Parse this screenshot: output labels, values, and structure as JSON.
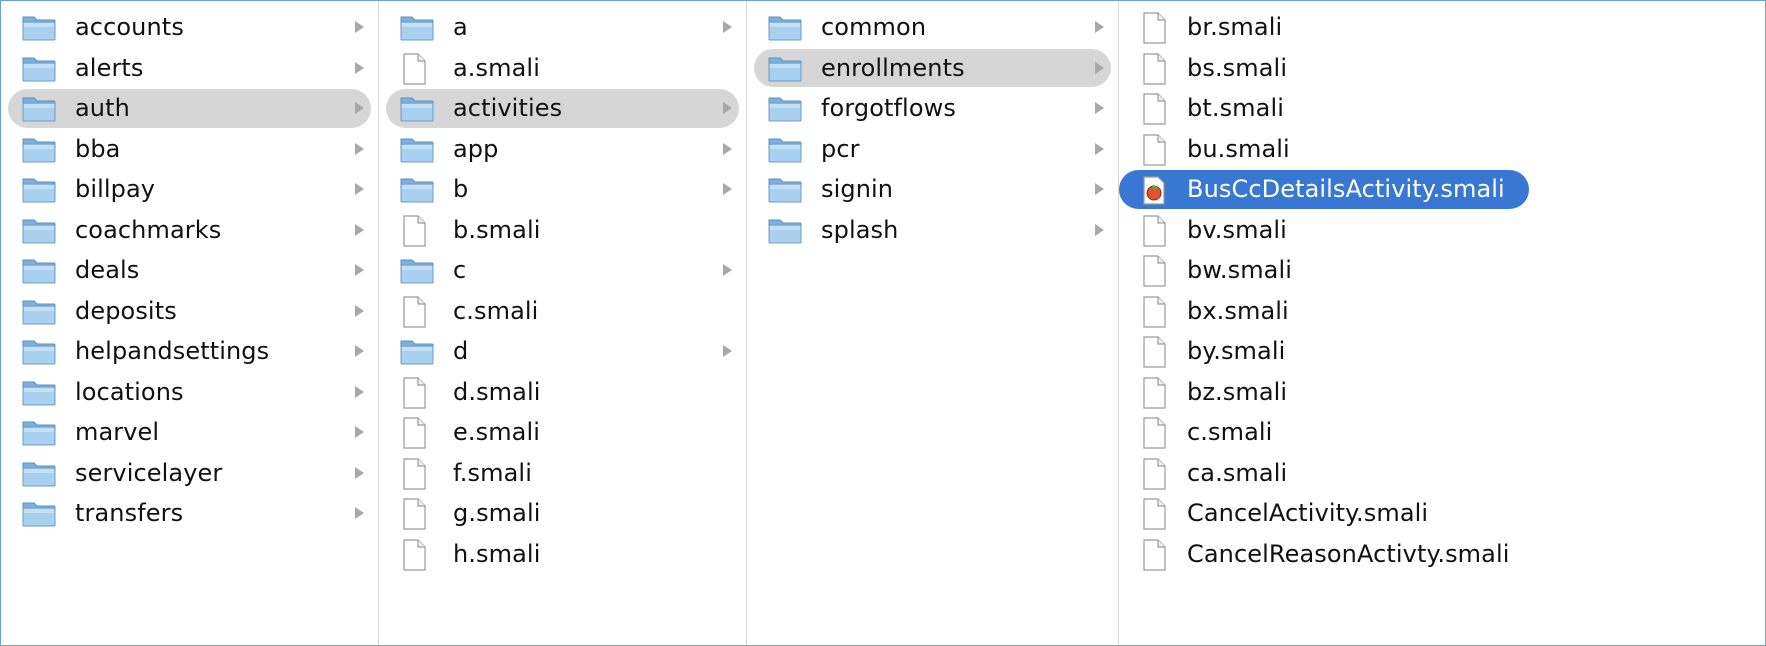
{
  "columns": [
    {
      "items": [
        {
          "label": "accounts",
          "kind": "folder"
        },
        {
          "label": "alerts",
          "kind": "folder"
        },
        {
          "label": "auth",
          "kind": "folder",
          "selected": "gray"
        },
        {
          "label": "bba",
          "kind": "folder"
        },
        {
          "label": "billpay",
          "kind": "folder"
        },
        {
          "label": "coachmarks",
          "kind": "folder"
        },
        {
          "label": "deals",
          "kind": "folder"
        },
        {
          "label": "deposits",
          "kind": "folder"
        },
        {
          "label": "helpandsettings",
          "kind": "folder"
        },
        {
          "label": "locations",
          "kind": "folder"
        },
        {
          "label": "marvel",
          "kind": "folder"
        },
        {
          "label": "servicelayer",
          "kind": "folder"
        },
        {
          "label": "transfers",
          "kind": "folder"
        }
      ]
    },
    {
      "items": [
        {
          "label": "a",
          "kind": "folder"
        },
        {
          "label": "a.smali",
          "kind": "file"
        },
        {
          "label": "activities",
          "kind": "folder",
          "selected": "gray"
        },
        {
          "label": "app",
          "kind": "folder"
        },
        {
          "label": "b",
          "kind": "folder"
        },
        {
          "label": "b.smali",
          "kind": "file"
        },
        {
          "label": "c",
          "kind": "folder"
        },
        {
          "label": "c.smali",
          "kind": "file"
        },
        {
          "label": "d",
          "kind": "folder"
        },
        {
          "label": "d.smali",
          "kind": "file"
        },
        {
          "label": "e.smali",
          "kind": "file"
        },
        {
          "label": "f.smali",
          "kind": "file"
        },
        {
          "label": "g.smali",
          "kind": "file"
        },
        {
          "label": "h.smali",
          "kind": "file"
        }
      ]
    },
    {
      "items": [
        {
          "label": "common",
          "kind": "folder"
        },
        {
          "label": "enrollments",
          "kind": "folder",
          "selected": "gray"
        },
        {
          "label": "forgotflows",
          "kind": "folder"
        },
        {
          "label": "pcr",
          "kind": "folder"
        },
        {
          "label": "signin",
          "kind": "folder"
        },
        {
          "label": "splash",
          "kind": "folder"
        }
      ]
    },
    {
      "items": [
        {
          "label": "br.smali",
          "kind": "file"
        },
        {
          "label": "bs.smali",
          "kind": "file"
        },
        {
          "label": "bt.smali",
          "kind": "file"
        },
        {
          "label": "bu.smali",
          "kind": "file"
        },
        {
          "label": "BusCcDetailsActivity.smali",
          "kind": "special",
          "selected": "blue"
        },
        {
          "label": "bv.smali",
          "kind": "file"
        },
        {
          "label": "bw.smali",
          "kind": "file"
        },
        {
          "label": "bx.smali",
          "kind": "file"
        },
        {
          "label": "by.smali",
          "kind": "file"
        },
        {
          "label": "bz.smali",
          "kind": "file"
        },
        {
          "label": "c.smali",
          "kind": "file"
        },
        {
          "label": "ca.smali",
          "kind": "file"
        },
        {
          "label": "CancelActivity.smali",
          "kind": "file"
        },
        {
          "label": "CancelReasonActivty.smali",
          "kind": "file"
        }
      ]
    }
  ],
  "colors": {
    "folder_fill": "#8fc0e6",
    "selection_gray": "#d6d6d6",
    "selection_blue": "#3877d3",
    "border": "#6aa4d6"
  },
  "icons": {
    "folder": "folder-icon",
    "file": "document-icon",
    "special": "smali-marked-file-icon",
    "disclosure": "disclosure-triangle-icon"
  }
}
